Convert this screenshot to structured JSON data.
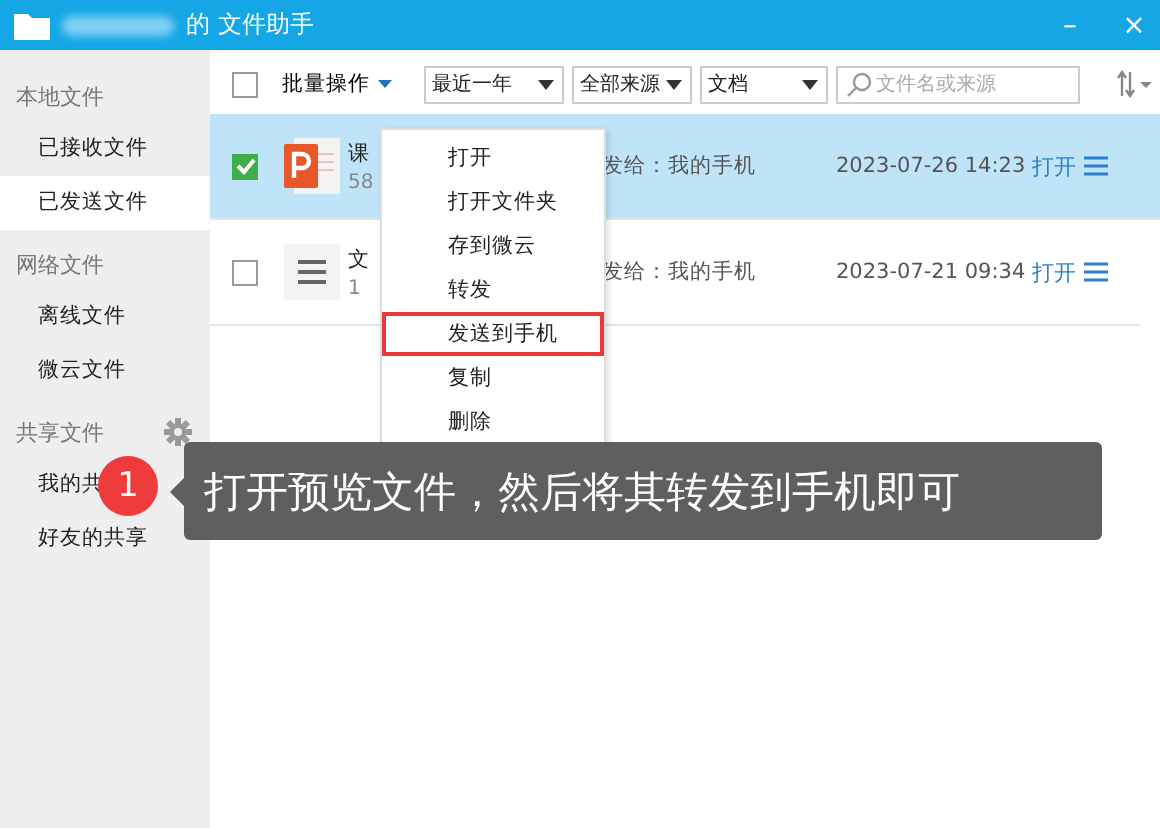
{
  "window": {
    "title": "的 文件助手",
    "controls": [
      "–",
      "×"
    ]
  },
  "sidebar": {
    "sections": [
      {
        "title": "本地文件",
        "settings": false,
        "items": [
          {
            "label": "已接收文件",
            "selected": false
          },
          {
            "label": "已发送文件",
            "selected": true
          }
        ]
      },
      {
        "title": "网络文件",
        "settings": false,
        "items": [
          {
            "label": "离线文件",
            "selected": false
          },
          {
            "label": "微云文件",
            "selected": false
          }
        ]
      },
      {
        "title": "共享文件",
        "settings": true,
        "items": [
          {
            "label": "我的共",
            "selected": false
          },
          {
            "label": "好友的共享",
            "selected": false
          }
        ]
      }
    ]
  },
  "toolbar": {
    "select_all_checked": false,
    "batch": "批量操作",
    "filters": [
      "最近一年",
      "全部来源",
      "文档"
    ],
    "search": {
      "placeholder": "文件名或来源"
    }
  },
  "files": [
    {
      "kind": "ppt",
      "name": "课",
      "size": "58",
      "target": "发给：我的手机",
      "time": "2023-07-26 14:23",
      "open": "打开",
      "checked": true,
      "selected": true
    },
    {
      "kind": "txt",
      "name": "文",
      "size": "1",
      "target": "发给：我的手机",
      "time": "2023-07-21 09:34",
      "open": "打开",
      "checked": false,
      "selected": false
    }
  ],
  "context_menu": [
    {
      "label": "打开",
      "highlighted": false
    },
    {
      "label": "打开文件夹",
      "highlighted": false
    },
    {
      "label": "存到微云",
      "highlighted": false
    },
    {
      "label": "转发",
      "highlighted": false
    },
    {
      "label": "发送到手机",
      "highlighted": true
    },
    {
      "label": "复制",
      "highlighted": false
    },
    {
      "label": "删除",
      "highlighted": false
    }
  ],
  "tip": {
    "step": "1",
    "text": "打开预览文件，然后将其转发到手机即可"
  }
}
